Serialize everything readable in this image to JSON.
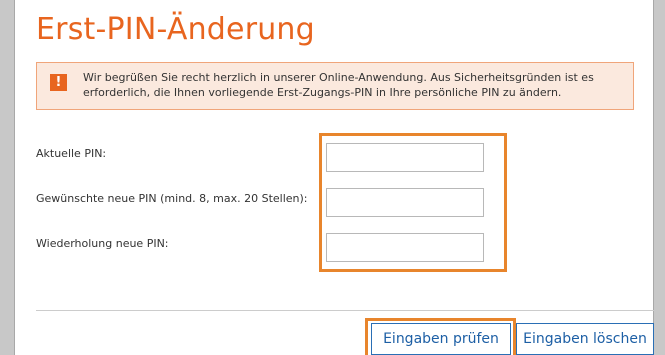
{
  "page": {
    "title": "Erst-PIN-Änderung"
  },
  "notice": {
    "icon": "warning-icon",
    "icon_glyph": "!",
    "text": "Wir begrüßen Sie recht herzlich in unserer Online-Anwendung. Aus Sicherheitsgründen ist es erforderlich, die Ihnen vorliegende Erst-Zugangs-PIN in Ihre persönliche PIN zu ändern."
  },
  "form": {
    "fields": [
      {
        "label": "Aktuelle PIN:",
        "value": ""
      },
      {
        "label": "Gewünschte neue PIN (mind. 8, max. 20 Stellen):",
        "value": ""
      },
      {
        "label": "Wiederholung neue PIN:",
        "value": ""
      }
    ]
  },
  "buttons": {
    "check_label": "Eingaben prüfen",
    "clear_label": "Eingaben löschen"
  },
  "colors": {
    "accent_orange": "#e8651f",
    "highlight_orange": "#e8852c",
    "button_blue": "#1d5fa5",
    "notice_background": "#fbe9de"
  }
}
